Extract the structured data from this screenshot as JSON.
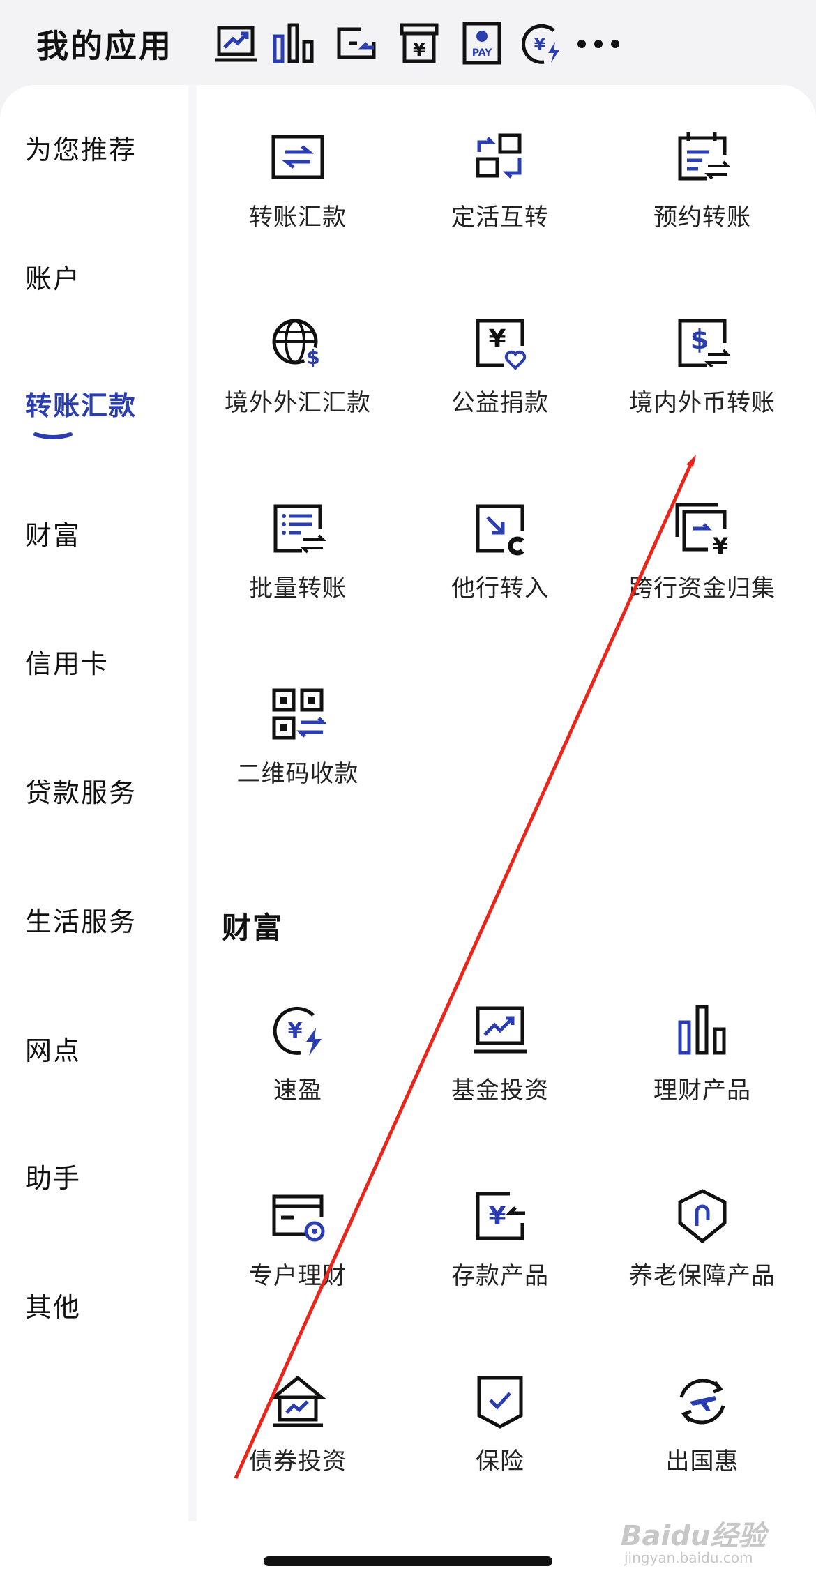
{
  "header": {
    "title": "我的应用",
    "shortcuts": [
      "fund-chart-icon",
      "bar-chart-icon",
      "deposit-icon",
      "yuan-box-icon",
      "pay-icon",
      "yuan-bolt-icon"
    ],
    "more": "more-icon"
  },
  "sidebar": {
    "items": [
      {
        "label": "为您推荐"
      },
      {
        "label": "账户"
      },
      {
        "label": "转账汇款"
      },
      {
        "label": "财富"
      },
      {
        "label": "信用卡"
      },
      {
        "label": "贷款服务"
      },
      {
        "label": "生活服务"
      },
      {
        "label": "网点"
      },
      {
        "label": "助手"
      },
      {
        "label": "其他"
      }
    ],
    "active_index": 2
  },
  "transfer": {
    "tiles": [
      {
        "label": "转账汇款",
        "icon": "transfer-icon"
      },
      {
        "label": "定活互转",
        "icon": "swap-grid-icon"
      },
      {
        "label": "预约转账",
        "icon": "calendar-transfer-icon"
      },
      {
        "label": "境外外汇汇款",
        "icon": "globe-dollar-icon"
      },
      {
        "label": "公益捐款",
        "icon": "yuan-heart-icon"
      },
      {
        "label": "境内外币转账",
        "icon": "dollar-transfer-icon"
      },
      {
        "label": "批量转账",
        "icon": "batch-transfer-icon"
      },
      {
        "label": "他行转入",
        "icon": "inbound-transfer-icon"
      },
      {
        "label": "跨行资金归集",
        "icon": "fund-collect-icon"
      },
      {
        "label": "二维码收款",
        "icon": "qr-code-icon"
      }
    ]
  },
  "wealth": {
    "title": "财富",
    "tiles": [
      {
        "label": "速盈",
        "icon": "yuan-bolt-icon"
      },
      {
        "label": "基金投资",
        "icon": "fund-chart-icon"
      },
      {
        "label": "理财产品",
        "icon": "bar-chart-icon"
      },
      {
        "label": "专户理财",
        "icon": "card-coin-icon"
      },
      {
        "label": "存款产品",
        "icon": "deposit-icon"
      },
      {
        "label": "养老保障产品",
        "icon": "shield-umbrella-icon"
      },
      {
        "label": "债券投资",
        "icon": "bond-house-icon"
      },
      {
        "label": "保险",
        "icon": "shield-check-icon"
      },
      {
        "label": "出国惠",
        "icon": "plane-cycle-icon"
      }
    ]
  },
  "watermark": {
    "brand": "Baidu经验",
    "url": "jingyan.baidu.com"
  },
  "colors": {
    "accent": "#2a3eb1",
    "annotation": "#e8261c",
    "ink": "#111111"
  }
}
